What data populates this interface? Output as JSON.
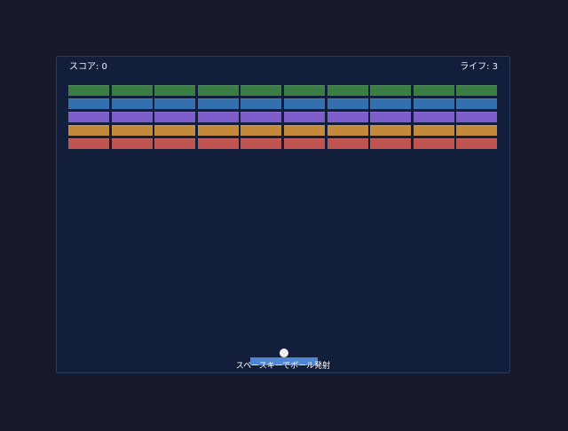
{
  "hud": {
    "score_text": "スコア: 0",
    "lives_text": "ライフ: 3",
    "score": 0,
    "lives": 3
  },
  "hint": {
    "text": "スペースキーでボール発射"
  },
  "colors": {
    "page_background": "#171a2b",
    "field_background": "#131f3a",
    "field_border": "#2a3c60",
    "paddle": "#4f86d3",
    "ball": "#f1f1f1",
    "text": "#f2f2f2"
  },
  "bricks": {
    "columns": 10,
    "rows": [
      {
        "color": "#3a7e45"
      },
      {
        "color": "#3470ad"
      },
      {
        "color": "#7c5dc9"
      },
      {
        "color": "#c48a3c"
      },
      {
        "color": "#c05450"
      }
    ]
  }
}
